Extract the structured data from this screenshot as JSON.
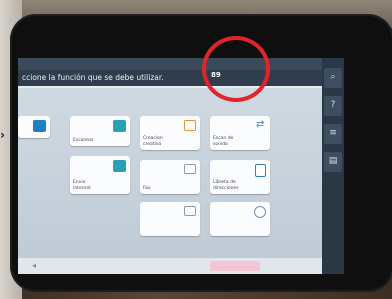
{
  "header": {
    "instruction": "ccione la función que se debe utilizar.",
    "counter_value": "89",
    "top_labels": [
      "",
      "",
      "",
      ""
    ]
  },
  "tiles": [
    {
      "label": "",
      "icon": "scanner-icon"
    },
    {
      "label": "Escanear",
      "icon": "scan-icon"
    },
    {
      "label": "Creacion creativa",
      "icon": "photo-icon"
    },
    {
      "label": "Escan de sonido",
      "icon": "document-scan-icon"
    },
    {
      "label": "Envio Internet",
      "icon": "send-icon"
    },
    {
      "label": "Fax",
      "icon": "fax-icon"
    },
    {
      "label": "Libreta de direcciones",
      "icon": "address-book-icon"
    },
    {
      "label": "",
      "icon": "folder-icon"
    },
    {
      "label": "",
      "icon": "link-icon"
    }
  ],
  "bottom": {
    "back_label": "",
    "start_label": ""
  }
}
